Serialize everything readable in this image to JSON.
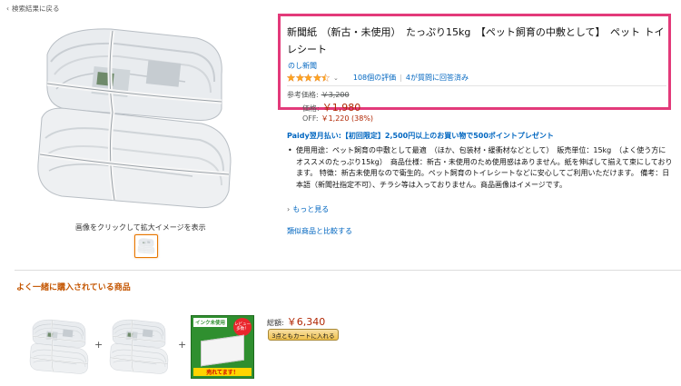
{
  "nav": {
    "back_label": "検索結果に戻る"
  },
  "gallery": {
    "caption": "画像をクリックして拡大イメージを表示"
  },
  "product": {
    "title": "新聞紙 （新古・未使用）　たっぷり15kg　【ペット飼育の中敷として】　ペット トイレシート",
    "brand": "のし新聞",
    "rating_value": 4.5,
    "reviews_label": "108個の評価",
    "separator": "|",
    "questions_label": "4が質問に回答済み"
  },
  "price": {
    "ref_label": "参考価格:",
    "ref_value": "￥3,200",
    "price_label": "価格:",
    "price_value": "￥1,980",
    "off_label": "OFF:",
    "off_value": "￥1,220 (38%)"
  },
  "promo": {
    "paidy": "Paidy翌月払い:【初回限定】2,500円以上のお買い物で500ポイントプレゼント"
  },
  "bullets": [
    "使用用途：ペット飼育の中敷として最適　（ほか、包装材・緩衝材などとして）　販売単位：15kg　（よく使う方にオススメのたっぷり15kg）　商品仕様：新古・未使用のため使用感はありません。紙を伸ばして揃えて束にしております。 特徴：新古未使用なので衛生的。ペット飼育のトイレシートなどに安心してご利用いただけます。 備考：日本語（新聞社指定不可）、チラシ等は入っておりません。商品画像はイメージです。"
  ],
  "links": {
    "more": "もっと見る",
    "compare": "類似商品と比較する"
  },
  "fbt": {
    "title": "よく一緒に購入されている商品",
    "plus": "+",
    "total_label": "総額:",
    "total_value": "￥6,340",
    "cart_button": "3点ともカートに入れる",
    "badge_text": "レビュー多数！",
    "badge_text2": "売れてます！",
    "ink_label": "インク未使用"
  },
  "colors": {
    "accent_highlight": "#e33a7a",
    "price_red": "#b12704",
    "link_blue": "#0066c0",
    "heading_orange": "#c45500",
    "star": "#ffa41c"
  }
}
